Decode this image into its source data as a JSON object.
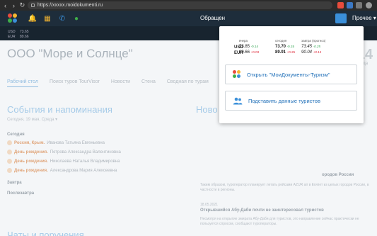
{
  "browser": {
    "url": "https://xxxxx.moidokumenti.ru"
  },
  "header": {
    "obrashch": "Обращен",
    "more": "Прочее ▾"
  },
  "rates_bg": {
    "usd": "USD",
    "eur": "EUR",
    "usd_val": "73.65",
    "eur_val": "89.66"
  },
  "page": {
    "company": "ООО \"Море и Солнце\"",
    "clock": "13:14",
    "date": "19 мая, Среда",
    "tabs": [
      "Рабочий стол",
      "Поиск туров TourVisor",
      "Новости",
      "Стена",
      "Сводная по турам"
    ],
    "events_title": "События и напоминания",
    "news_title": "Ново",
    "events_sub": "Сегодня, 19 мая, Среда ▾",
    "today": "Сегодня",
    "events": [
      {
        "kind": "Россия, Крым.",
        "name": "Иванова Татьяна Евгеньевна"
      },
      {
        "kind": "День рождения.",
        "name": "Петрова Александра Валентиновна"
      },
      {
        "kind": "День рождения.",
        "name": "Николаева Наталья Владимировна"
      },
      {
        "kind": "День рождения.",
        "name": "Александрова Мария Алексеевна"
      }
    ],
    "tomorrow": "Завтра",
    "day_after": "Послезавтра",
    "news_head1": "ородов России",
    "news_text1": "Таким образом, туроператор планирует летать рейсами AZUR air в Египет из целых городов России, в частности в регионы.",
    "news_date": "18.05.2021",
    "news_head2": "Открывшийся Абу-Даби почти не заинтересовал туристов",
    "news_text2": "Несмотря на открытие эмирата Абу-Даби для туристов, это направление сейчас практически не пользуется спросом, сообщают туроператоры.",
    "bottom_title": "Чаты и поручения"
  },
  "popup": {
    "headers": {
      "buy": "вчера",
      "today": "сегодня",
      "tomorrow": "завтра (прогноз)"
    },
    "rows": [
      {
        "cur": "USD",
        "y": "73.85",
        "yd": "-0.14",
        "t": "73.70",
        "td": "-0.15",
        "m": "73.45",
        "md": "-0.25"
      },
      {
        "cur": "EUR",
        "y": "89.66",
        "yd": "+0.03",
        "t": "89.91",
        "td": "+0.25",
        "m": "90.04",
        "md": "+0.14"
      }
    ],
    "btn_open": "Открыть \"МоиДокументы-Туризм\"",
    "btn_tourists": "Подставить данные туристов"
  },
  "colors": {
    "accent": "#1f6fb8",
    "header_bg": "#1e2d3b",
    "down": "#2aa24a",
    "up": "#dd2233"
  },
  "icons": [
    "back-icon",
    "forward-icon",
    "reload-icon",
    "lock-icon",
    "bell-icon",
    "calculator-icon",
    "phone-icon",
    "chat-icon",
    "dots-logo-icon",
    "people-icon"
  ]
}
